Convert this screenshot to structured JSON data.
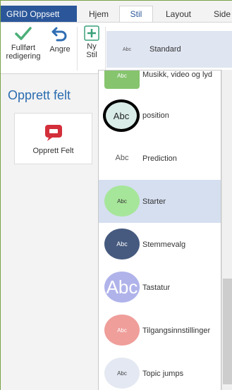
{
  "ribbon_tabs": {
    "app": "GRID Oppsett",
    "home": "Hjem",
    "style": "Stil",
    "layout": "Layout",
    "page": "Side"
  },
  "ribbon": {
    "finish_label": "Fullført redigering",
    "undo_label": "Angre",
    "new_style_label": "Ny Stil",
    "current_style_abc": "Abc",
    "current_style_name": "Standard"
  },
  "left_panel": {
    "title": "Opprett felt",
    "create_button_label": "Opprett Felt"
  },
  "styles": [
    {
      "abc": "Abc",
      "name": "Musikk, video og lyd",
      "fill": "#86c46e",
      "text": "#ffffff"
    },
    {
      "abc": "Abc",
      "name": "position",
      "fill": "#d9ece8",
      "text": "#222222"
    },
    {
      "abc": "Abc",
      "name": "Prediction",
      "fill": "#ffffff",
      "text": "#555555"
    },
    {
      "abc": "Abc",
      "name": "Starter",
      "fill": "#a6e69a",
      "text": "#333333"
    },
    {
      "abc": "Abc",
      "name": "Stemmevalg",
      "fill": "#465a7f",
      "text": "#ffffff"
    },
    {
      "abc": "Abc",
      "name": "Tastatur",
      "fill": "#b0b3ea",
      "text": "#ffffff"
    },
    {
      "abc": "Abc",
      "name": "Tilgangsinnstillinger",
      "fill": "#ef9e9a",
      "text": "#ffffff"
    },
    {
      "abc": "Abc",
      "name": "Topic jumps",
      "fill": "#e3e8f2",
      "text": "#444444"
    }
  ],
  "colors": {
    "accent": "#2b579a",
    "check": "#4caf78",
    "undo": "#2f6db3",
    "new_style": "#3aa17a",
    "create_icon": "#d32f3a",
    "selected_row": "#d5dff0"
  }
}
